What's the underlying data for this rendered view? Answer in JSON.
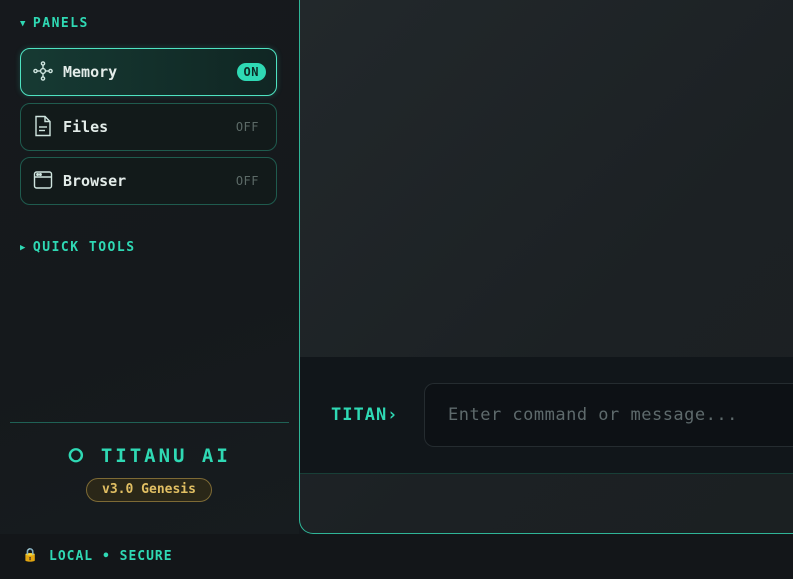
{
  "sidebar": {
    "panels_header": "PANELS",
    "quick_tools_header": "QUICK TOOLS",
    "panels": [
      {
        "label": "Memory",
        "state": "ON",
        "icon": "network-nodes-icon"
      },
      {
        "label": "Files",
        "state": "OFF",
        "icon": "file-icon"
      },
      {
        "label": "Browser",
        "state": "OFF",
        "icon": "browser-window-icon"
      }
    ],
    "brand": "⭘ TITANU AI",
    "version": "v3.0 Genesis"
  },
  "command": {
    "prompt": "TITAN›",
    "placeholder": "Enter command or message..."
  },
  "status": {
    "lock_icon": "🔒",
    "text": "LOCAL • SECURE"
  },
  "colors": {
    "accent": "#2fd9b4",
    "badge_gold": "#e1bf63",
    "background": "#14181c"
  }
}
